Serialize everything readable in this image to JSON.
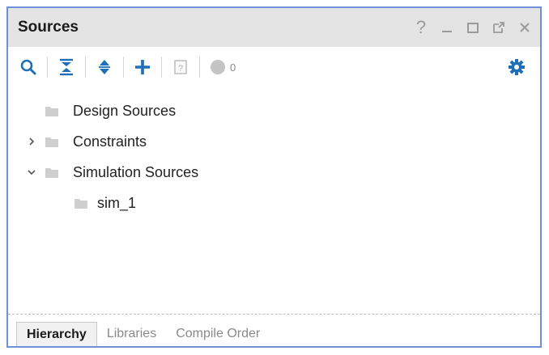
{
  "panel": {
    "title": "Sources",
    "window_controls": [
      "?",
      "minimize",
      "maximize",
      "float",
      "close"
    ]
  },
  "toolbar": {
    "items": [
      "search-icon",
      "collapse-all-icon",
      "expand-all-icon",
      "add-icon",
      "unknown-file-icon"
    ],
    "status_count": "0",
    "settings_icon": "gear-icon"
  },
  "tree": {
    "items": [
      {
        "label": "Design Sources",
        "expander": "none",
        "level": 0
      },
      {
        "label": "Constraints",
        "expander": "collapsed",
        "level": 0
      },
      {
        "label": "Simulation Sources",
        "expander": "expanded",
        "level": 0
      },
      {
        "label": "sim_1",
        "expander": "none",
        "level": 1
      }
    ]
  },
  "tabs": {
    "items": [
      "Hierarchy",
      "Libraries",
      "Compile Order"
    ],
    "active": "Hierarchy"
  },
  "colors": {
    "accent": "#1e6fb8",
    "border": "#6f8fd6",
    "titlebar": "#e4e4e4",
    "folder": "#cfcfcf"
  }
}
